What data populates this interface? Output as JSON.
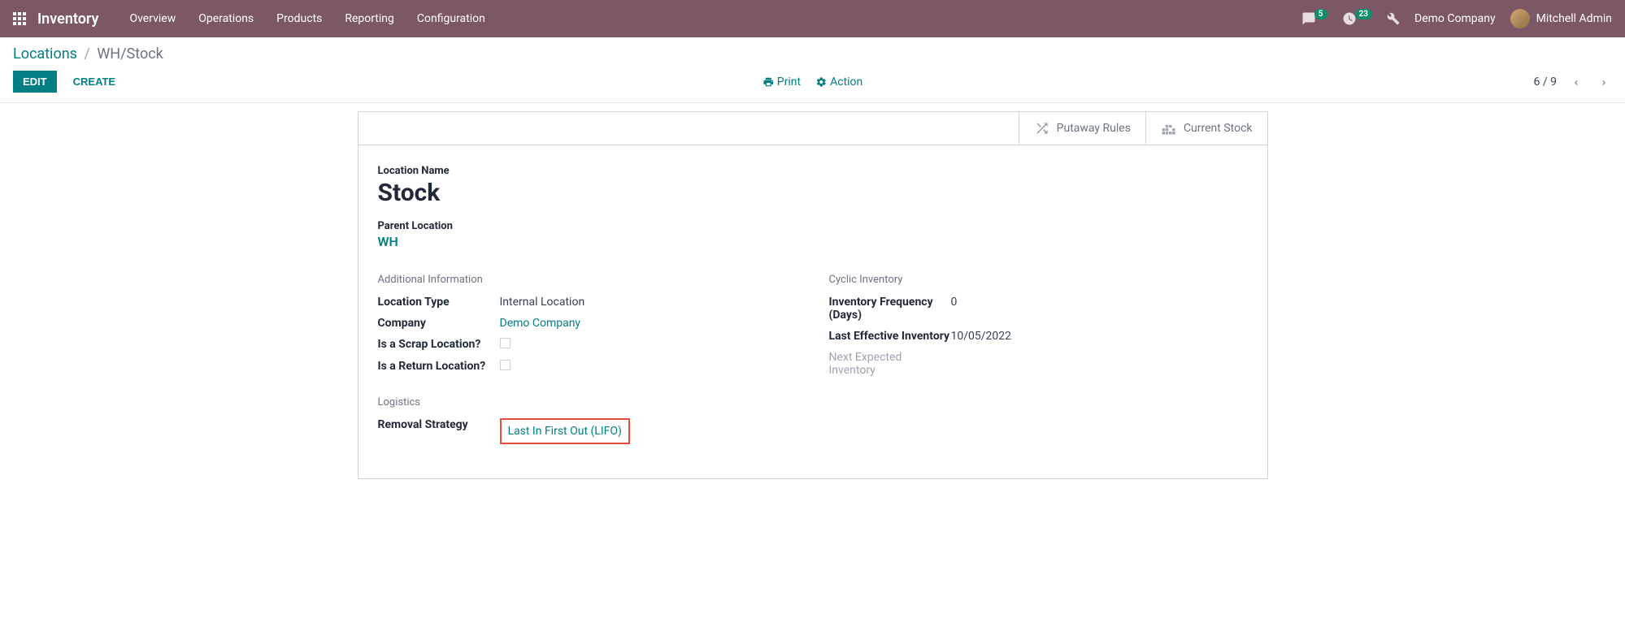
{
  "navbar": {
    "app_title": "Inventory",
    "menu": [
      "Overview",
      "Operations",
      "Products",
      "Reporting",
      "Configuration"
    ],
    "chat_badge": "5",
    "activity_badge": "23",
    "company": "Demo Company",
    "user": "Mitchell Admin"
  },
  "breadcrumb": {
    "parent": "Locations",
    "current": "WH/Stock"
  },
  "buttons": {
    "edit": "EDIT",
    "create": "CREATE",
    "print": "Print",
    "action": "Action"
  },
  "pager": {
    "text": "6 / 9"
  },
  "stat_buttons": {
    "putaway": "Putaway Rules",
    "stock": "Current Stock"
  },
  "form": {
    "location_name_label": "Location Name",
    "location_name": "Stock",
    "parent_label": "Parent Location",
    "parent_value": "WH",
    "sections": {
      "additional": {
        "title": "Additional Information",
        "location_type_label": "Location Type",
        "location_type": "Internal Location",
        "company_label": "Company",
        "company": "Demo Company",
        "scrap_label": "Is a Scrap Location?",
        "return_label": "Is a Return Location?"
      },
      "cyclic": {
        "title": "Cyclic Inventory",
        "freq_label": "Inventory Frequency (Days)",
        "freq": "0",
        "last_label": "Last Effective Inventory",
        "last": "10/05/2022",
        "next_label": "Next Expected Inventory"
      },
      "logistics": {
        "title": "Logistics",
        "removal_label": "Removal Strategy",
        "removal_value": "Last In First Out (LIFO)"
      }
    }
  }
}
